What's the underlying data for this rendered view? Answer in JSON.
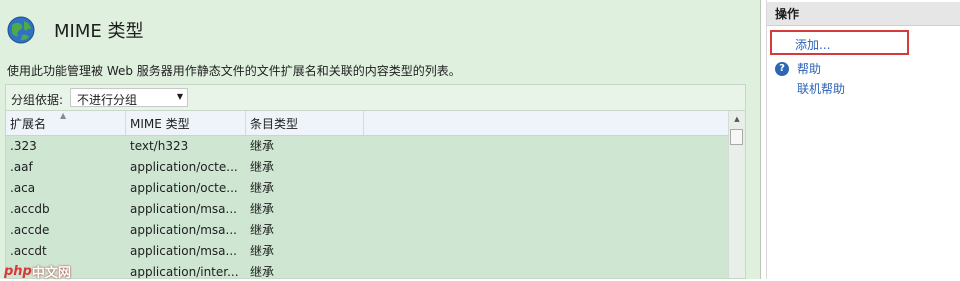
{
  "page": {
    "title": "MIME 类型",
    "description": "使用此功能管理被 Web 服务器用作静态文件的文件扩展名和关联的内容类型的列表。",
    "group_label": "分组依据:",
    "group_value": "不进行分组"
  },
  "grid": {
    "columns": [
      "扩展名",
      "MIME 类型",
      "条目类型"
    ],
    "rows": [
      {
        "ext": ".323",
        "mime": "text/h323",
        "type": "继承"
      },
      {
        "ext": ".aaf",
        "mime": "application/octe...",
        "type": "继承"
      },
      {
        "ext": ".aca",
        "mime": "application/octe...",
        "type": "继承"
      },
      {
        "ext": ".accdb",
        "mime": "application/msa...",
        "type": "继承"
      },
      {
        "ext": ".accde",
        "mime": "application/msa...",
        "type": "继承"
      },
      {
        "ext": ".accdt",
        "mime": "application/msa...",
        "type": "继承"
      },
      {
        "ext": "",
        "mime": "application/inter...",
        "type": "继承"
      }
    ]
  },
  "actions": {
    "header": "操作",
    "add": "添加...",
    "help": "帮助",
    "online_help": "联机帮助"
  },
  "watermark": {
    "text_php": "php",
    "text_site": "中文网"
  },
  "colors": {
    "main_bg": "#dff0df",
    "link": "#2d63b7",
    "highlight_border": "#d43b3b"
  }
}
